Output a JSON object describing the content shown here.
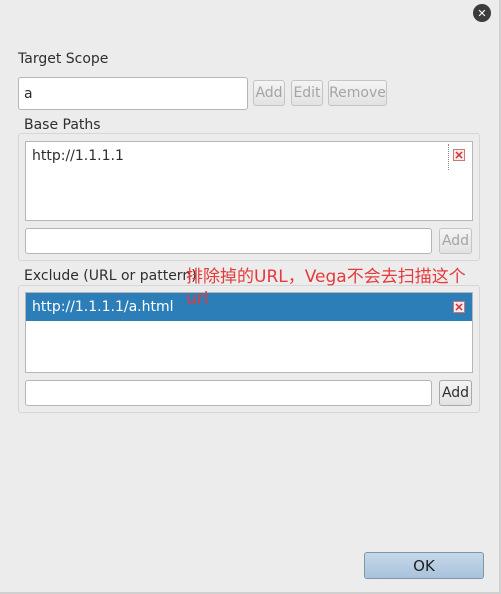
{
  "dialog": {
    "close_icon": "close-icon",
    "ok_label": "OK"
  },
  "target_scope": {
    "label": "Target Scope",
    "value": "a",
    "add_label": "Add",
    "edit_label": "Edit",
    "remove_label": "Remove"
  },
  "base_paths": {
    "label": "Base Paths",
    "items": [
      "http://1.1.1.1"
    ],
    "input_value": "",
    "add_label": "Add"
  },
  "exclude": {
    "label": "Exclude (URL or pattern)",
    "items": [
      "http://1.1.1.1/a.html"
    ],
    "input_value": "",
    "add_label": "Add"
  },
  "annotation": {
    "line1": "排除掉的URL，Vega不会去扫描这个",
    "line2": "url",
    "color": "#e53a3a"
  },
  "colors": {
    "selection": "#2c7eb9",
    "background": "#ececec"
  }
}
